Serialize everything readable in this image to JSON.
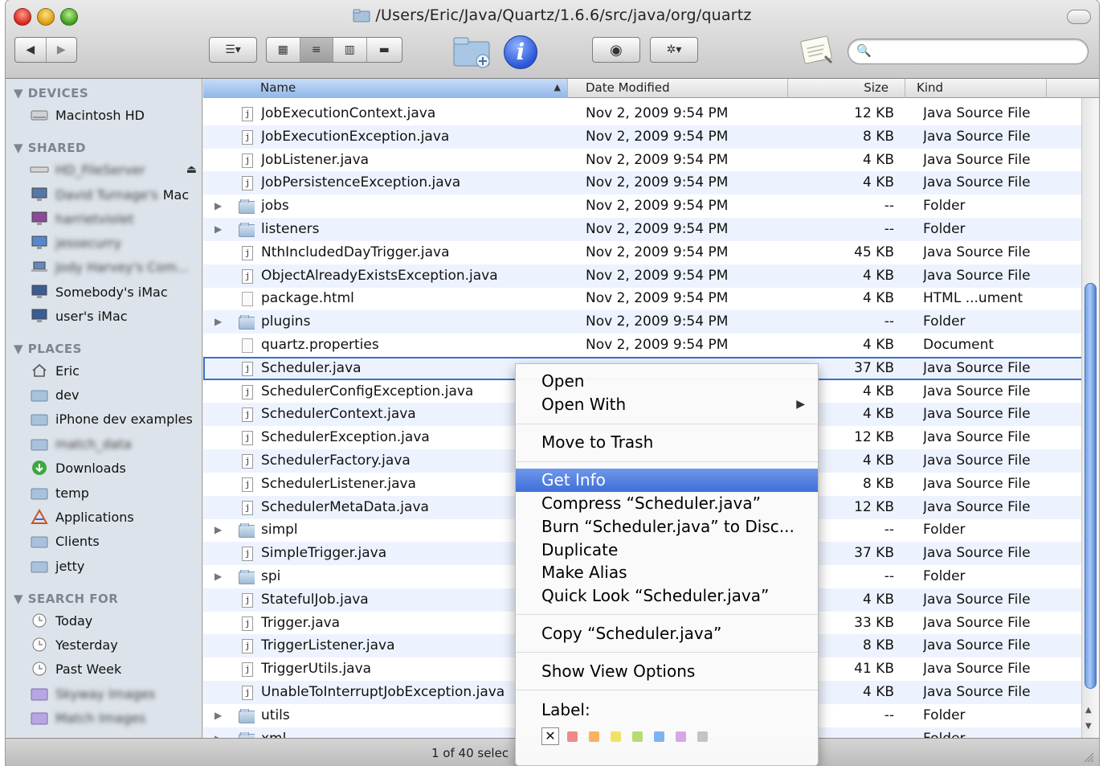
{
  "window": {
    "title": "/Users/Eric/Java/Quartz/1.6.6/src/java/org/quartz"
  },
  "sidebar": {
    "devices_heading": "▼ DEVICES",
    "devices": [
      {
        "label": "Macintosh HD",
        "icon": "hard-drive-icon"
      }
    ],
    "shared_heading": "▼ SHARED",
    "shared": [
      {
        "label": "HD_FileServer",
        "icon": "server-icon",
        "blurred": true
      },
      {
        "label": "Mac",
        "icon": "imac-icon",
        "blurred_prefix": "David Turnage's"
      },
      {
        "label": "harrietviolet",
        "icon": "imac-icon",
        "blurred": true
      },
      {
        "label": "jessecurry",
        "icon": "imac-icon",
        "blurred": true
      },
      {
        "label": "Jody Harvey's Com...",
        "icon": "laptop-icon",
        "blurred": true
      },
      {
        "label": "Somebody's iMac",
        "icon": "imac-icon"
      },
      {
        "label": "user's iMac",
        "icon": "imac-icon"
      }
    ],
    "places_heading": "▼ PLACES",
    "places": [
      {
        "label": "Eric",
        "icon": "home-icon"
      },
      {
        "label": "dev",
        "icon": "folder-icon"
      },
      {
        "label": "iPhone dev examples",
        "icon": "folder-icon"
      },
      {
        "label": "match_data",
        "icon": "folder-icon",
        "blurred": true
      },
      {
        "label": "Downloads",
        "icon": "downloads-icon"
      },
      {
        "label": "temp",
        "icon": "folder-icon"
      },
      {
        "label": "Applications",
        "icon": "applications-icon"
      },
      {
        "label": "Clients",
        "icon": "folder-icon"
      },
      {
        "label": "jetty",
        "icon": "folder-icon"
      }
    ],
    "search_heading": "▼ SEARCH FOR",
    "searches": [
      {
        "label": "Today",
        "icon": "clock-icon"
      },
      {
        "label": "Yesterday",
        "icon": "clock-icon"
      },
      {
        "label": "Past Week",
        "icon": "clock-icon"
      },
      {
        "label": "Skyway Images",
        "icon": "smart-folder-icon",
        "blurred": true
      },
      {
        "label": "Match Images",
        "icon": "smart-folder-icon",
        "blurred": true
      }
    ]
  },
  "columns": {
    "name": "Name",
    "date": "Date Modified",
    "size": "Size",
    "kind": "Kind",
    "sort_indicator": "▲"
  },
  "files": [
    {
      "name": "JobExecutionContext.java",
      "date": "Nov 2, 2009 9:54 PM",
      "size": "12 KB",
      "kind": "Java Source File",
      "type": "java"
    },
    {
      "name": "JobExecutionException.java",
      "date": "Nov 2, 2009 9:54 PM",
      "size": "8 KB",
      "kind": "Java Source File",
      "type": "java"
    },
    {
      "name": "JobListener.java",
      "date": "Nov 2, 2009 9:54 PM",
      "size": "4 KB",
      "kind": "Java Source File",
      "type": "java"
    },
    {
      "name": "JobPersistenceException.java",
      "date": "Nov 2, 2009 9:54 PM",
      "size": "4 KB",
      "kind": "Java Source File",
      "type": "java"
    },
    {
      "name": "jobs",
      "date": "Nov 2, 2009 9:54 PM",
      "size": "--",
      "kind": "Folder",
      "type": "folder"
    },
    {
      "name": "listeners",
      "date": "Nov 2, 2009 9:54 PM",
      "size": "--",
      "kind": "Folder",
      "type": "folder"
    },
    {
      "name": "NthIncludedDayTrigger.java",
      "date": "Nov 2, 2009 9:54 PM",
      "size": "45 KB",
      "kind": "Java Source File",
      "type": "java"
    },
    {
      "name": "ObjectAlreadyExistsException.java",
      "date": "Nov 2, 2009 9:54 PM",
      "size": "4 KB",
      "kind": "Java Source File",
      "type": "java"
    },
    {
      "name": "package.html",
      "date": "Nov 2, 2009 9:54 PM",
      "size": "4 KB",
      "kind": "HTML ...ument",
      "type": "file"
    },
    {
      "name": "plugins",
      "date": "Nov 2, 2009 9:54 PM",
      "size": "--",
      "kind": "Folder",
      "type": "folder"
    },
    {
      "name": "quartz.properties",
      "date": "Nov 2, 2009 9:54 PM",
      "size": "4 KB",
      "kind": "Document",
      "type": "file"
    },
    {
      "name": "Scheduler.java",
      "date": "",
      "size": "37 KB",
      "kind": "Java Source File",
      "type": "java",
      "selected": true
    },
    {
      "name": "SchedulerConfigException.java",
      "date": "",
      "size": "4 KB",
      "kind": "Java Source File",
      "type": "java"
    },
    {
      "name": "SchedulerContext.java",
      "date": "",
      "size": "4 KB",
      "kind": "Java Source File",
      "type": "java"
    },
    {
      "name": "SchedulerException.java",
      "date": "",
      "size": "12 KB",
      "kind": "Java Source File",
      "type": "java"
    },
    {
      "name": "SchedulerFactory.java",
      "date": "",
      "size": "4 KB",
      "kind": "Java Source File",
      "type": "java"
    },
    {
      "name": "SchedulerListener.java",
      "date": "",
      "size": "8 KB",
      "kind": "Java Source File",
      "type": "java"
    },
    {
      "name": "SchedulerMetaData.java",
      "date": "",
      "size": "12 KB",
      "kind": "Java Source File",
      "type": "java"
    },
    {
      "name": "simpl",
      "date": "",
      "size": "--",
      "kind": "Folder",
      "type": "folder"
    },
    {
      "name": "SimpleTrigger.java",
      "date": "",
      "size": "37 KB",
      "kind": "Java Source File",
      "type": "java"
    },
    {
      "name": "spi",
      "date": "",
      "size": "--",
      "kind": "Folder",
      "type": "folder"
    },
    {
      "name": "StatefulJob.java",
      "date": "",
      "size": "4 KB",
      "kind": "Java Source File",
      "type": "java"
    },
    {
      "name": "Trigger.java",
      "date": "",
      "size": "33 KB",
      "kind": "Java Source File",
      "type": "java"
    },
    {
      "name": "TriggerListener.java",
      "date": "",
      "size": "8 KB",
      "kind": "Java Source File",
      "type": "java"
    },
    {
      "name": "TriggerUtils.java",
      "date": "",
      "size": "41 KB",
      "kind": "Java Source File",
      "type": "java"
    },
    {
      "name": "UnableToInterruptJobException.java",
      "date": "",
      "size": "4 KB",
      "kind": "Java Source File",
      "type": "java"
    },
    {
      "name": "utils",
      "date": "",
      "size": "--",
      "kind": "Folder",
      "type": "folder"
    },
    {
      "name": "xml",
      "date": "",
      "size": "",
      "kind": "Folder",
      "type": "folder"
    }
  ],
  "status": {
    "text": "1 of 40 selec"
  },
  "context_menu": {
    "items": [
      {
        "label": "Open"
      },
      {
        "label": "Open With",
        "submenu": true
      },
      {
        "label": "Move to Trash"
      },
      {
        "label": "Get Info",
        "highlighted": true
      },
      {
        "label": "Compress “Scheduler.java”"
      },
      {
        "label": "Burn “Scheduler.java” to Disc..."
      },
      {
        "label": "Duplicate"
      },
      {
        "label": "Make Alias"
      },
      {
        "label": "Quick Look “Scheduler.java”"
      },
      {
        "label": "Copy “Scheduler.java”"
      },
      {
        "label": "Show View Options"
      },
      {
        "label": "Label:"
      }
    ],
    "label_colors": [
      "#f08a8a",
      "#f6b463",
      "#f2e168",
      "#b5dc72",
      "#7fb2f0",
      "#d7a6e8",
      "#c4c4c4"
    ],
    "no_label_glyph": "✕",
    "submenu_arrow": "▶"
  },
  "toolbar": {
    "back_glyph": "◀",
    "forward_glyph": "▶",
    "arrange_glyph": "☰▾",
    "view_icon_glyph": "▦",
    "view_list_glyph": "≡",
    "view_column_glyph": "▥",
    "view_coverflow_glyph": "▬",
    "info_glyph": "i",
    "quicklook_glyph": "◉",
    "action_glyph": "✲▾",
    "search_glyph": "🔍",
    "search_value": ""
  }
}
